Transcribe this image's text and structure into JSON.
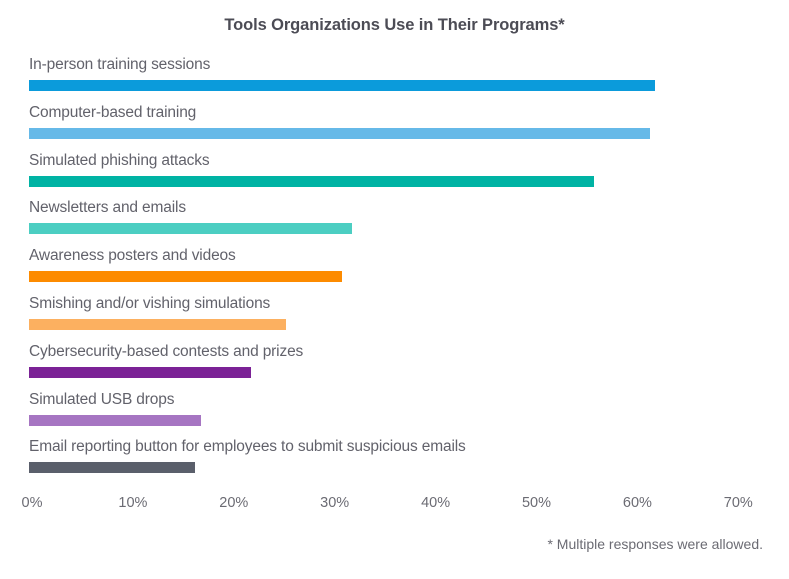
{
  "chart_data": {
    "type": "bar",
    "orientation": "horizontal",
    "title": "Tools Organizations Use in Their Programs*",
    "xlabel": "",
    "ylabel": "",
    "xlim": [
      0,
      70
    ],
    "grid": false,
    "legend": null,
    "footnote": "* Multiple responses were allowed.",
    "tick_labels": [
      "0%",
      "10%",
      "20%",
      "30%",
      "40%",
      "50%",
      "60%",
      "70%"
    ],
    "tick_values": [
      0,
      10,
      20,
      30,
      40,
      50,
      60,
      70
    ],
    "categories": [
      "In-person training sessions",
      "Computer-based training",
      "Simulated phishing attacks",
      "Newsletters and emails",
      "Awareness posters and videos",
      "Smishing and/or vishing simulations",
      "Cybersecurity-based contests and prizes",
      "Simulated USB drops",
      "Email reporting button for employees to submit suspicious emails"
    ],
    "values": [
      62,
      61.5,
      56,
      32,
      31,
      25.5,
      22,
      17,
      16.5
    ],
    "colors": [
      "#0b9bdb",
      "#66b9e8",
      "#00b3a4",
      "#4ccec2",
      "#fd8b00",
      "#fcb060",
      "#7b2296",
      "#a675c2",
      "#5a5f6b"
    ],
    "bars": [
      {
        "label": "In-person training sessions",
        "value": 62,
        "color": "#0b9bdb"
      },
      {
        "label": "Computer-based training",
        "value": 61.5,
        "color": "#66b9e8"
      },
      {
        "label": "Simulated phishing attacks",
        "value": 56,
        "color": "#00b3a4"
      },
      {
        "label": "Newsletters and emails",
        "value": 32,
        "color": "#4ccec2"
      },
      {
        "label": "Awareness posters and videos",
        "value": 31,
        "color": "#fd8b00"
      },
      {
        "label": "Smishing and/or vishing simulations",
        "value": 25.5,
        "color": "#fcb060"
      },
      {
        "label": "Cybersecurity-based contests and prizes",
        "value": 22,
        "color": "#7b2296"
      },
      {
        "label": "Simulated USB drops",
        "value": 17,
        "color": "#a675c2"
      },
      {
        "label": "Email reporting button for employees to submit suspicious emails",
        "value": 16.5,
        "color": "#5a5f6b"
      }
    ]
  }
}
